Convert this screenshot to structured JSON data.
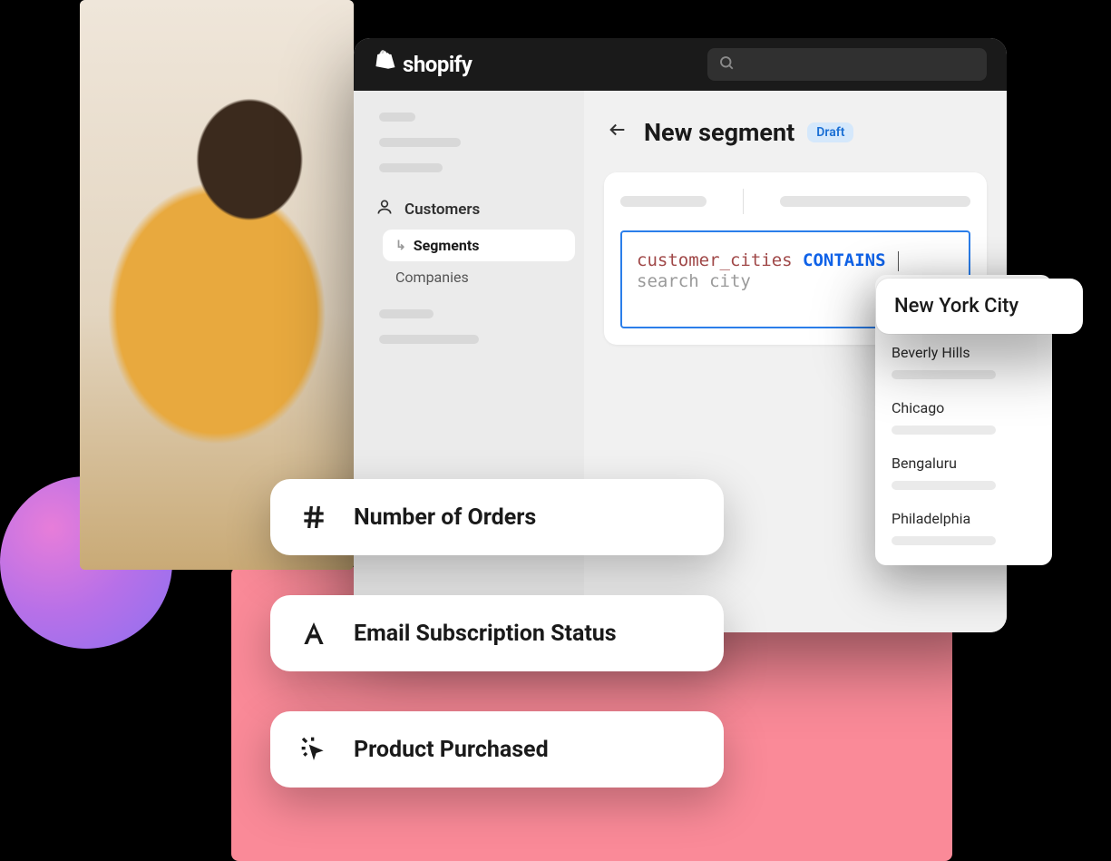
{
  "brand": "shopify",
  "sidebar": {
    "customers": "Customers",
    "segments": "Segments",
    "companies": "Companies"
  },
  "page": {
    "title": "New segment",
    "badge": "Draft"
  },
  "editor": {
    "field": "customer_cities",
    "operator": "CONTAINS",
    "placeholder": "search city"
  },
  "dropdown": {
    "highlight": "New York City",
    "items": [
      "Beverly Hills",
      "Chicago",
      "Bengaluru",
      "Philadelphia"
    ]
  },
  "criteria": {
    "orders": "Number of Orders",
    "email": "Email Subscription Status",
    "product": "Product Purchased"
  }
}
